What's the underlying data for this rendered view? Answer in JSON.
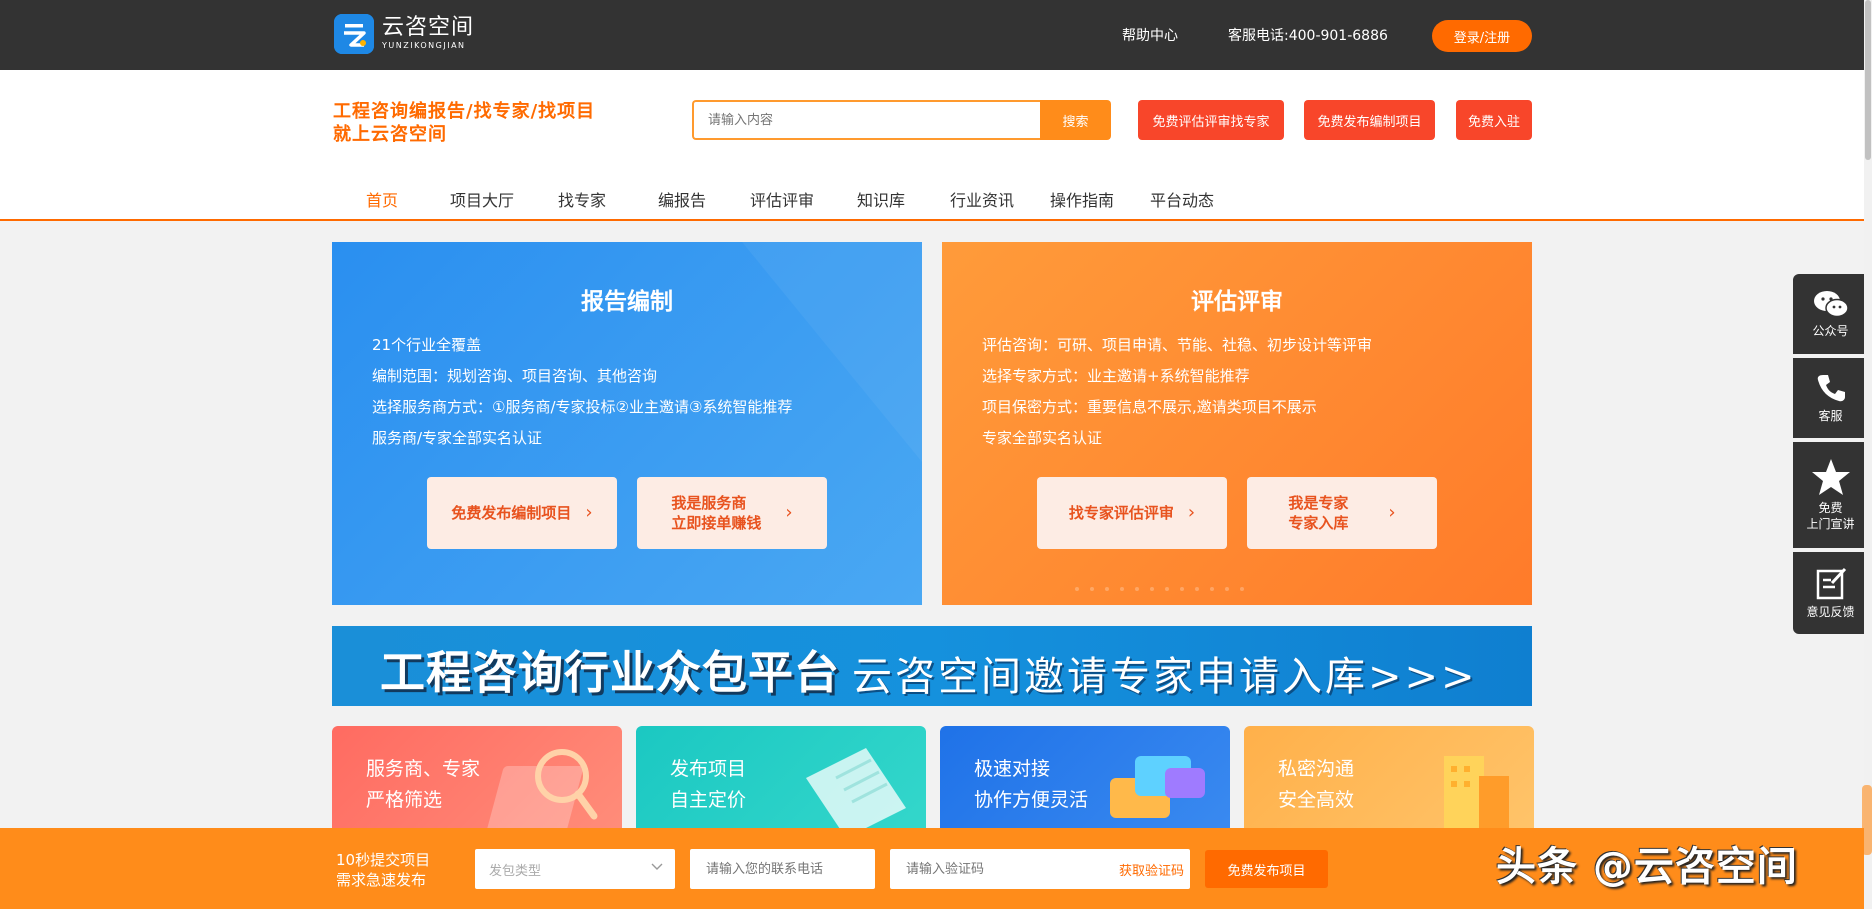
{
  "topbar": {
    "logo_cn": "云咨空间",
    "logo_en": "YUNZIKONGJIAN",
    "help": "帮助中心",
    "phone": "客服电话:400-901-6886",
    "login": "登录/注册"
  },
  "header": {
    "slogan_line1": "工程咨询编报告/找专家/找项目",
    "slogan_line2": "就上云咨空间",
    "search_placeholder": "请输入内容",
    "search_button": "搜索",
    "btn_find_expert": "免费评估评审找专家",
    "btn_publish": "免费发布编制项目",
    "btn_join": "免费入驻"
  },
  "nav": [
    "首页",
    "项目大厅",
    "找专家",
    "编报告",
    "评估评审",
    "知识库",
    "行业资讯",
    "操作指南",
    "平台动态"
  ],
  "card_report": {
    "title": "报告编制",
    "lines": [
      "21个行业全覆盖",
      "编制范围：规划咨询、项目咨询、其他咨询",
      "选择服务商方式：①服务商/专家投标②业主邀请③系统智能推荐",
      "服务商/专家全部实名认证"
    ],
    "btn1": "免费发布编制项目",
    "btn2_line1": "我是服务商",
    "btn2_line2": "立即接单赚钱"
  },
  "card_review": {
    "title": "评估评审",
    "lines": [
      "评估咨询：可研、项目申请、节能、社稳、初步设计等评审",
      "选择专家方式：业主邀请+系统智能推荐",
      "项目保密方式：重要信息不展示,邀请类项目不展示",
      "专家全部实名认证"
    ],
    "btn1": "找专家评估评审",
    "btn2_line1": "我是专家",
    "btn2_line2": "专家入库"
  },
  "banner": {
    "left": "工程咨询行业众包平台",
    "right": "云咨空间邀请专家申请入库>>>"
  },
  "tiles": [
    {
      "line1": "服务商、专家",
      "line2": "严格筛选"
    },
    {
      "line1": "发布项目",
      "line2": "自主定价"
    },
    {
      "line1": "极速对接",
      "line2": "协作方便灵活"
    },
    {
      "line1": "私密沟通",
      "line2": "安全高效"
    }
  ],
  "sidebar": {
    "wechat": "公众号",
    "service": "客服",
    "free_line1": "免费",
    "free_line2": "上门宣讲",
    "feedback": "意见反馈"
  },
  "bottombar": {
    "text_line1": "10秒提交项目",
    "text_line2": "需求急速发布",
    "type_placeholder": "发包类型",
    "phone_placeholder": "请输入您的联系电话",
    "code_placeholder": "请输入验证码",
    "get_code": "获取验证码",
    "submit": "免费发布项目"
  },
  "watermark": "头条 @云咨空间",
  "colors": {
    "brand_orange": "#ff6a00",
    "topbar_dark": "#333333",
    "card_blue": "#2a8ff0",
    "card_orange": "#ff8a30",
    "red_button": "#f8462a"
  }
}
